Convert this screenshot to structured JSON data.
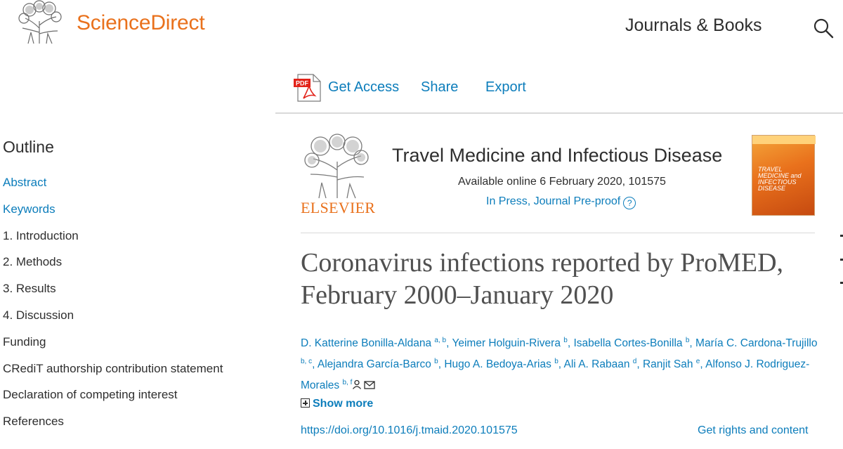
{
  "header": {
    "brand": "ScienceDirect",
    "journals_link": "Journals & Books",
    "search_icon": "search-icon"
  },
  "toolbar": {
    "pdf_icon": "pdf-icon",
    "get_access": "Get Access",
    "share": "Share",
    "export": "Export"
  },
  "outline": {
    "title": "Outline",
    "items": [
      {
        "label": "Abstract",
        "link": true
      },
      {
        "label": "Keywords",
        "link": true
      },
      {
        "label": "1. Introduction",
        "link": false
      },
      {
        "label": "2. Methods",
        "link": false
      },
      {
        "label": "3. Results",
        "link": false
      },
      {
        "label": "4. Discussion",
        "link": false
      },
      {
        "label": "Funding",
        "link": false
      },
      {
        "label": "CRediT authorship contribution statement",
        "link": false
      },
      {
        "label": "Declaration of competing interest",
        "link": false
      },
      {
        "label": "References",
        "link": false
      }
    ]
  },
  "journal": {
    "publisher": "ELSEVIER",
    "title": "Travel Medicine and Infectious Disease",
    "available": "Available online 6 February 2020, 101575",
    "status": "In Press, Journal Pre-proof",
    "help_icon": "?",
    "cover_text": "TRAVEL MEDICINE and INFECTIOUS DISEASE"
  },
  "article": {
    "title": "Coronavirus infections reported by ProMED, February 2000–January 2020",
    "authors": [
      {
        "name": "D. Katterine Bonilla-Aldana",
        "sup": "a, b"
      },
      {
        "name": "Yeimer Holguin-Rivera",
        "sup": "b"
      },
      {
        "name": "Isabella Cortes-Bonilla",
        "sup": "b"
      },
      {
        "name": "María C. Cardona-Trujillo",
        "sup": "b, c"
      },
      {
        "name": "Alejandra García-Barco",
        "sup": "b"
      },
      {
        "name": "Hugo A. Bedoya-Arias",
        "sup": "b"
      },
      {
        "name": "Ali A. Rabaan",
        "sup": "d"
      },
      {
        "name": "Ranjit Sah",
        "sup": "e"
      },
      {
        "name": "Alfonso J. Rodriguez-Morales",
        "sup": "b, f"
      }
    ],
    "author_icons": [
      "person-icon",
      "envelope-icon"
    ],
    "show_more": "Show more",
    "doi": "https://doi.org/10.1016/j.tmaid.2020.101575",
    "rights": "Get rights and content"
  },
  "colors": {
    "brand_orange": "#e9711c",
    "link_blue": "#0c7dbb",
    "text": "#2e2e2e"
  }
}
